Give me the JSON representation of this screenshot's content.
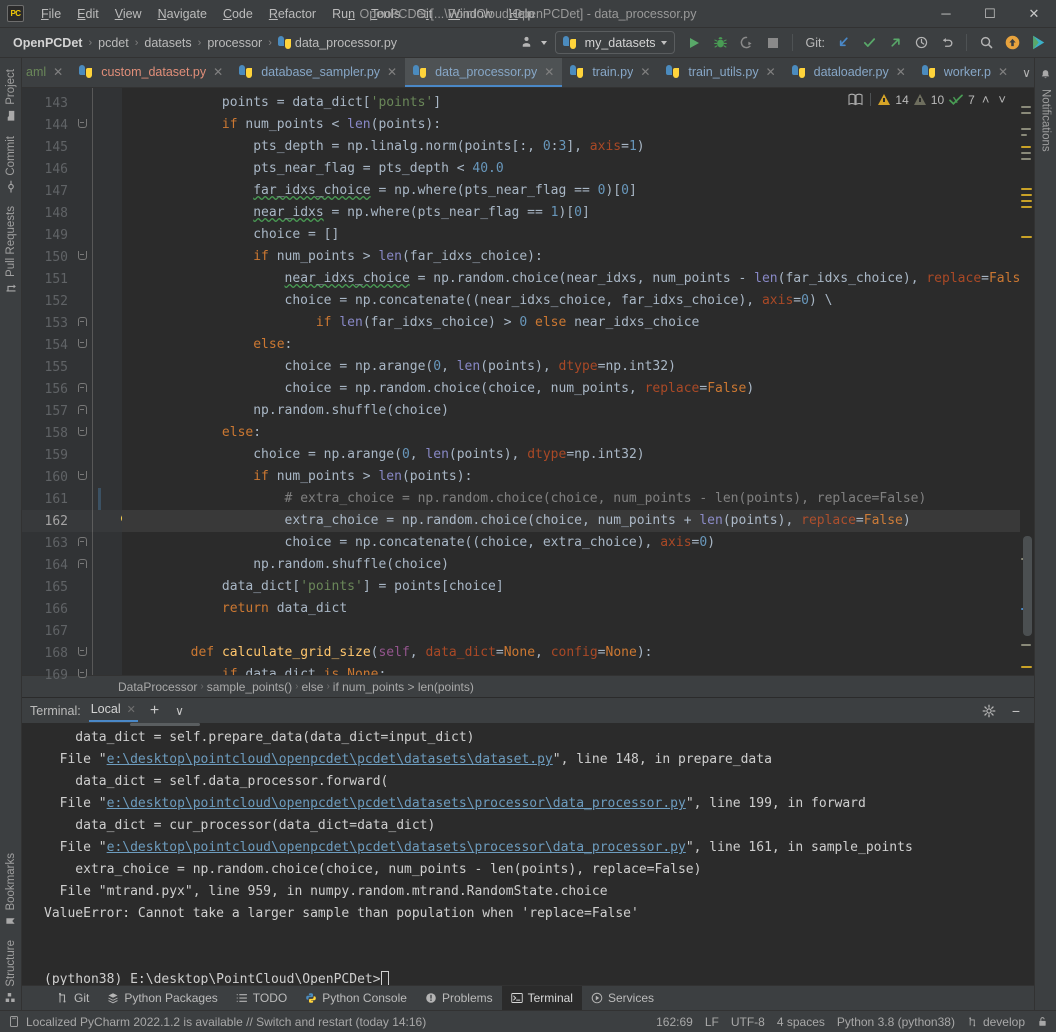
{
  "window": {
    "app_badge": "PC",
    "title": "OpenPCDet [...\\PointCloud\\OpenPCDet] - data_processor.py",
    "minimize": "─",
    "maximize": "☐",
    "close": "✕"
  },
  "menubar": [
    {
      "label": "File"
    },
    {
      "label": "Edit"
    },
    {
      "label": "View"
    },
    {
      "label": "Navigate"
    },
    {
      "label": "Code"
    },
    {
      "label": "Refactor"
    },
    {
      "label": "Run"
    },
    {
      "label": "Tools"
    },
    {
      "label": "Git"
    },
    {
      "label": "Window"
    },
    {
      "label": "Help"
    }
  ],
  "navbar": {
    "breadcrumbs": [
      {
        "label": "OpenPCDet",
        "bold": true,
        "icon": null
      },
      {
        "label": "pcdet",
        "bold": false,
        "icon": null
      },
      {
        "label": "datasets",
        "bold": false,
        "icon": null
      },
      {
        "label": "processor",
        "bold": false,
        "icon": null
      },
      {
        "label": "data_processor.py",
        "bold": false,
        "icon": "python-file-icon"
      }
    ],
    "separator": "›",
    "run_config": "my_datasets",
    "git_label": "Git:",
    "buttons": [
      {
        "name": "run-button",
        "glyph": "▶"
      },
      {
        "name": "debug-button",
        "glyph": "bug"
      },
      {
        "name": "run-with-coverage-button",
        "glyph": "coverage"
      },
      {
        "name": "stop-button",
        "glyph": "■"
      },
      {
        "name": "git-update-project-button",
        "glyph": "↙"
      },
      {
        "name": "git-commit-button",
        "glyph": "✓"
      },
      {
        "name": "git-push-button",
        "glyph": "↗"
      },
      {
        "name": "git-history-button",
        "glyph": "◷"
      },
      {
        "name": "git-rollback-button",
        "glyph": "↺"
      },
      {
        "name": "search-everywhere-button",
        "glyph": "⚲"
      },
      {
        "name": "updates-available-button",
        "glyph": "↑"
      },
      {
        "name": "ide-feature-button",
        "glyph": "▶"
      }
    ]
  },
  "left_stripe": {
    "top": [
      {
        "label": "Project",
        "icon": "project-folder-icon"
      },
      {
        "label": "Commit",
        "icon": "commit-icon"
      },
      {
        "label": "Pull Requests",
        "icon": "pull-request-icon"
      }
    ],
    "bottom": [
      {
        "label": "Bookmarks",
        "icon": "bookmark-icon"
      },
      {
        "label": "Structure",
        "icon": "structure-icon"
      }
    ]
  },
  "right_stripe": {
    "items": [
      {
        "label": "Notifications",
        "icon": "notifications-icon"
      }
    ]
  },
  "tabs": {
    "items": [
      {
        "label": "aml",
        "color": "#6a8759",
        "active": false,
        "truncated": true,
        "icon": "yaml-file-icon"
      },
      {
        "label": "custom_dataset.py",
        "color": "#e08e79",
        "active": false,
        "icon": "python-file-icon"
      },
      {
        "label": "database_sampler.py",
        "color": "#87a7c7",
        "active": false,
        "icon": "python-file-icon"
      },
      {
        "label": "data_processor.py",
        "color": "#87a7c7",
        "active": true,
        "icon": "python-file-icon"
      },
      {
        "label": "train.py",
        "color": "#87a7c7",
        "active": false,
        "icon": "python-file-icon"
      },
      {
        "label": "train_utils.py",
        "color": "#87a7c7",
        "active": false,
        "icon": "python-file-icon"
      },
      {
        "label": "dataloader.py",
        "color": "#87a7c7",
        "active": false,
        "icon": "python-file-icon"
      },
      {
        "label": "worker.p",
        "color": "#87a7c7",
        "active": false,
        "truncated": true,
        "icon": "python-file-icon"
      }
    ],
    "overflow_chevron": "∨",
    "more_menu": "⋮"
  },
  "editor": {
    "first_line_number": 143,
    "current_line_number": 162,
    "inspections": {
      "reader_mode_icon": "book-icon",
      "warnings": "14",
      "weak_warnings": "10",
      "typos": "7",
      "prev_icon": "˄",
      "next_icon": "˅"
    },
    "lines": [
      {
        "n": 143,
        "fold": null,
        "html": "            points = data_dict[<s>'points'</s>]"
      },
      {
        "n": 144,
        "fold": "down",
        "html": "            <k>if</k> num_points &lt; <b>len</b>(points):"
      },
      {
        "n": 145,
        "fold": null,
        "html": "                pts_depth = np.linalg.norm(points[:, <n>0</n>:<n>3</n>], <a>axis</a>=<n>1</n>)"
      },
      {
        "n": 146,
        "fold": null,
        "html": "                pts_near_flag = pts_depth &lt; <n>40.0</n>"
      },
      {
        "n": 147,
        "fold": null,
        "html": "                <w>far_idxs_choice</w> = np.where(pts_near_flag == <n>0</n>)[<n>0</n>]"
      },
      {
        "n": 148,
        "fold": null,
        "html": "                <w>near_idxs</w> = np.where(pts_near_flag == <n>1</n>)[<n>0</n>]"
      },
      {
        "n": 149,
        "fold": null,
        "html": "                choice = []"
      },
      {
        "n": 150,
        "fold": "down",
        "html": "                <k>if</k> num_points &gt; <b>len</b>(far_idxs_choice):"
      },
      {
        "n": 151,
        "fold": null,
        "html": "                    <w>near_idxs_choice</w> = np.random.choice(near_idxs, num_points - <b>len</b>(far_idxs_choice), <a>replace</a>=<k>False</k>)"
      },
      {
        "n": 152,
        "fold": null,
        "html": "                    choice = np.concatenate((near_idxs_choice, far_idxs_choice), <a>axis</a>=<n>0</n>) \\"
      },
      {
        "n": 153,
        "fold": "up",
        "html": "                        <k>if</k> <b>len</b>(far_idxs_choice) &gt; <n>0</n> <k>else</k> near_idxs_choice"
      },
      {
        "n": 154,
        "fold": "down",
        "html": "                <k>else</k>:"
      },
      {
        "n": 155,
        "fold": null,
        "html": "                    choice = np.arange(<n>0</n>, <b>len</b>(points), <a>dtype</a>=np.int32)"
      },
      {
        "n": 156,
        "fold": "up",
        "html": "                    choice = np.random.choice(choice, num_points, <a>replace</a>=<k>False</k>)"
      },
      {
        "n": 157,
        "fold": "up",
        "html": "                np.random.shuffle(choice)"
      },
      {
        "n": 158,
        "fold": "down",
        "html": "            <k>else</k>:"
      },
      {
        "n": 159,
        "fold": null,
        "html": "                choice = np.arange(<n>0</n>, <b>len</b>(points), <a>dtype</a>=np.int32)"
      },
      {
        "n": 160,
        "fold": "down",
        "html": "                <k>if</k> num_points &gt; <b>len</b>(points):"
      },
      {
        "n": 161,
        "fold": null,
        "html": "                    <c># extra_choice = np.random.choice(choice, num_points - len(points), replace=False)</c>"
      },
      {
        "n": 162,
        "fold": null,
        "html": "                    extra_choice = np.random.choice(choice, num_points + <b>len</b>(points), <a>replace</a>=<k>False</k>)",
        "bulb": true,
        "current": true
      },
      {
        "n": 163,
        "fold": "up",
        "html": "                    choice = np.concatenate((choice, extra_choice), <a>axis</a>=<n>0</n>)"
      },
      {
        "n": 164,
        "fold": "up",
        "html": "                np.random.shuffle(choice)"
      },
      {
        "n": 165,
        "fold": null,
        "html": "            data_dict[<s>'points'</s>] = points[choice]"
      },
      {
        "n": 166,
        "fold": null,
        "html": "            <k>return</k> data_dict"
      },
      {
        "n": 167,
        "fold": null,
        "html": ""
      },
      {
        "n": 168,
        "fold": "down",
        "html": "        <k>def</k> <f>calculate_grid_size</f>(<self>self</self>, <a>data_dict</a>=<k>None</k>, <a>config</a>=<k>None</k>):"
      },
      {
        "n": 169,
        "fold": "down",
        "html": "            <k>if</k> data_dict <k>is</k> <k>None</k>:"
      }
    ],
    "breadcrumbs": [
      "DataProcessor",
      "sample_points()",
      "else",
      "if num_points > len(points)"
    ],
    "breadcrumb_sep": "›"
  },
  "terminal": {
    "label": "Terminal:",
    "tab": "Local",
    "tab_close": "✕",
    "add_icon": "+",
    "dropdown_icon": "∨",
    "settings_icon": "gear-icon",
    "hide_icon": "−",
    "lines": [
      {
        "parts": [
          {
            "t": "    data_dict = self.prepare_data(data_dict=input_dict)"
          }
        ]
      },
      {
        "parts": [
          {
            "t": "  File \""
          },
          {
            "t": "e:\\desktop\\pointcloud\\openpcdet\\pcdet\\datasets\\dataset.py",
            "link": true
          },
          {
            "t": "\", line 148, in prepare_data"
          }
        ]
      },
      {
        "parts": [
          {
            "t": "    data_dict = self.data_processor.forward("
          }
        ]
      },
      {
        "parts": [
          {
            "t": "  File \""
          },
          {
            "t": "e:\\desktop\\pointcloud\\openpcdet\\pcdet\\datasets\\processor\\data_processor.py",
            "link": true
          },
          {
            "t": "\", line 199, in forward"
          }
        ]
      },
      {
        "parts": [
          {
            "t": "    data_dict = cur_processor(data_dict=data_dict)"
          }
        ]
      },
      {
        "parts": [
          {
            "t": "  File \""
          },
          {
            "t": "e:\\desktop\\pointcloud\\openpcdet\\pcdet\\datasets\\processor\\data_processor.py",
            "link": true
          },
          {
            "t": "\", line 161, in sample_points"
          }
        ]
      },
      {
        "parts": [
          {
            "t": "    extra_choice = np.random.choice(choice, num_points - len(points), replace=False)"
          }
        ]
      },
      {
        "parts": [
          {
            "t": "  File \"mtrand.pyx\", line 959, in numpy.random.mtrand.RandomState.choice"
          }
        ]
      },
      {
        "parts": [
          {
            "t": "ValueError: Cannot take a larger sample than population when 'replace=False'"
          }
        ]
      },
      {
        "parts": [
          {
            "t": ""
          }
        ]
      },
      {
        "parts": [
          {
            "t": ""
          }
        ]
      },
      {
        "parts": [
          {
            "t": "(python38) E:\\desktop\\PointCloud\\OpenPCDet>"
          },
          {
            "cursor": true
          }
        ]
      }
    ]
  },
  "bottom_bar": {
    "items": [
      {
        "label": "Git",
        "icon": "git-branch-icon",
        "active": false
      },
      {
        "label": "Python Packages",
        "icon": "packages-icon",
        "active": false
      },
      {
        "label": "TODO",
        "icon": "todo-icon",
        "active": false
      },
      {
        "label": "Python Console",
        "icon": "python-console-icon",
        "active": false
      },
      {
        "label": "Problems",
        "icon": "problems-icon",
        "active": false
      },
      {
        "label": "Terminal",
        "icon": "terminal-icon",
        "active": true
      },
      {
        "label": "Services",
        "icon": "services-icon",
        "active": false
      }
    ]
  },
  "statusbar": {
    "message": "Localized PyCharm 2022.1.2 is available // Switch and restart (today 14:16)",
    "message_icon": "ide-update-icon",
    "caret_position": "162:69",
    "line_separator": "LF",
    "encoding": "UTF-8",
    "indent": "4 spaces",
    "interpreter": "Python 3.8 (python38)",
    "branch": "develop",
    "branch_icon": "git-branch-icon",
    "lock_icon": "lock-icon"
  },
  "colors": {
    "accent": "#4a88c7",
    "warning": "#d6a427",
    "ok": "#59a869",
    "editor_bg": "#2b2b2b",
    "chrome_bg": "#3c3f41"
  }
}
